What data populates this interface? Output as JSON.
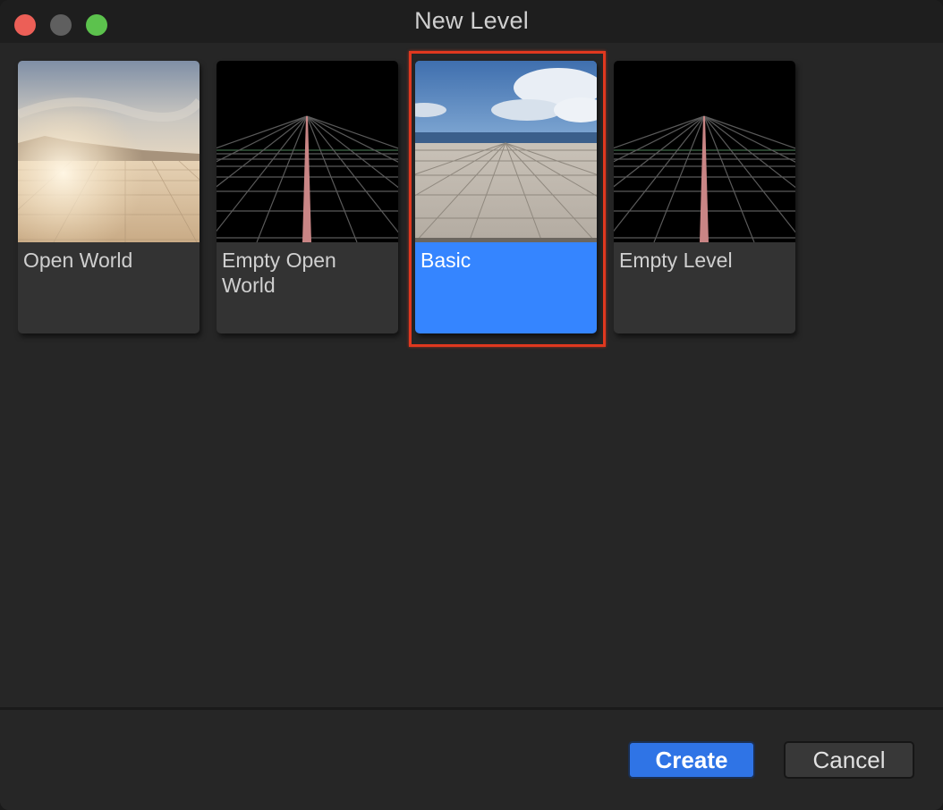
{
  "window": {
    "title": "New Level"
  },
  "templates": [
    {
      "label": "Open World",
      "thumbnail": "desert-landscape",
      "selected": false
    },
    {
      "label": "Empty Open World",
      "thumbnail": "dark-grid",
      "selected": false
    },
    {
      "label": "Basic",
      "thumbnail": "sky-tiled-floor",
      "selected": true
    },
    {
      "label": "Empty Level",
      "thumbnail": "dark-grid",
      "selected": false
    }
  ],
  "buttons": {
    "create_label": "Create",
    "cancel_label": "Cancel"
  },
  "colors": {
    "selected_card": "#3585ff",
    "highlight_outline": "#e0381f",
    "primary_button": "#2f74e6"
  }
}
